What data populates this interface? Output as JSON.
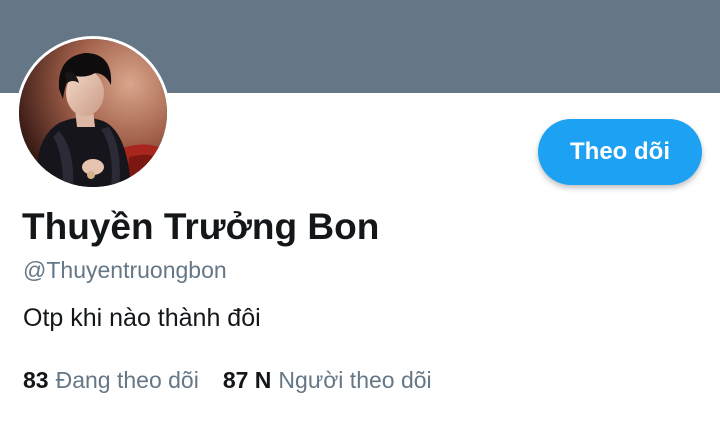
{
  "colors": {
    "banner": "#657786",
    "accent": "#1da1f2",
    "text_primary": "#14171a",
    "text_secondary": "#657786"
  },
  "profile": {
    "display_name": "Thuyền Trưởng Bon",
    "handle": "@Thuyentruongbon",
    "bio": "Otp khi nào thành đôi",
    "avatar_icon": "profile-photo"
  },
  "actions": {
    "follow_label": "Theo dõi"
  },
  "stats": {
    "following_count": "83",
    "following_label": "Đang theo dõi",
    "followers_count": "87 N",
    "followers_label": "Người theo dõi"
  }
}
